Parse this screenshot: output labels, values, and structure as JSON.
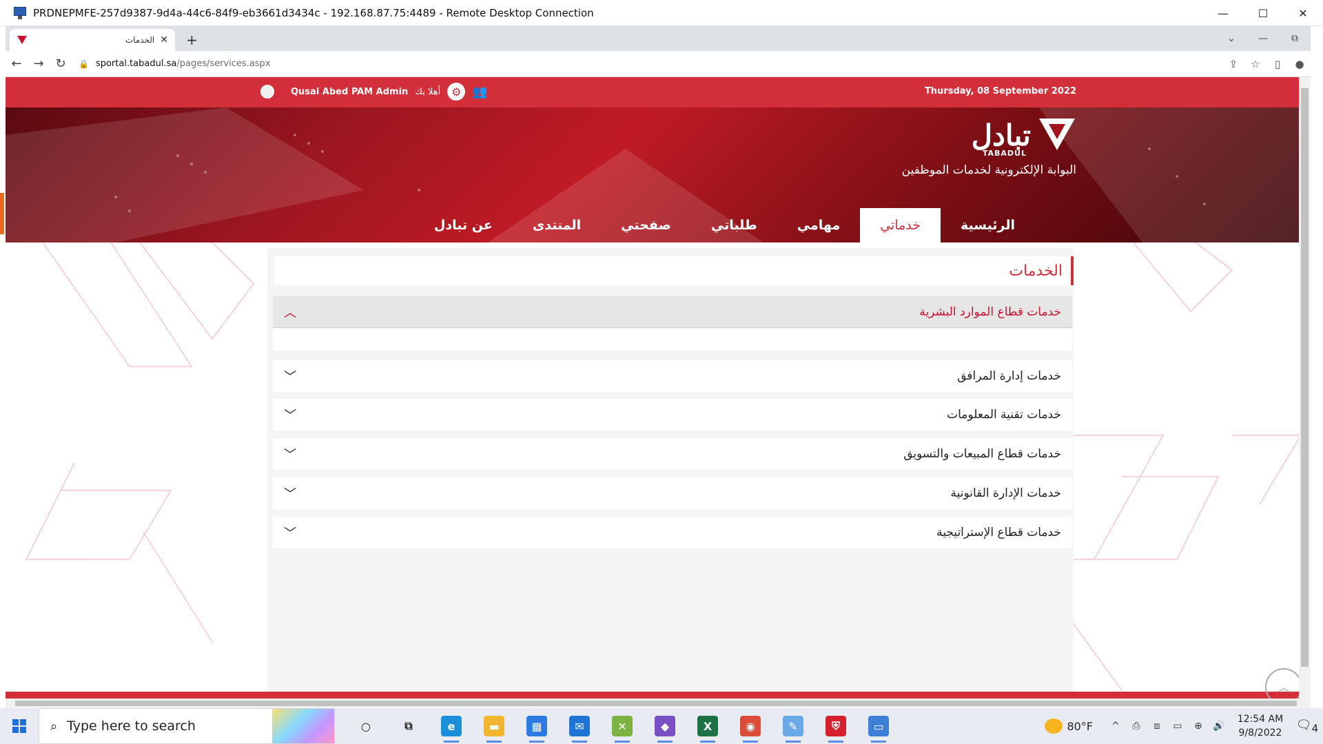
{
  "window": {
    "title": "PRDNEPMFE-257d9387-9d4a-44c6-84f9-eb3661d3434c - 192.168.87.75:4489 - Remote Desktop Connection",
    "controls": [
      "—",
      "☐",
      "✕"
    ]
  },
  "browser": {
    "tab_title": "الخدمات",
    "tab_close": "✕",
    "new_tab": "+",
    "tab_right": [
      "⌄",
      "—",
      "⧉"
    ],
    "url_host": "sportal.tabadul.sa",
    "url_path": "/pages/services.aspx",
    "nav": {
      "back": "←",
      "forward": "→",
      "reload": "↻"
    },
    "omni_right": [
      "⇪",
      "☆",
      "▯",
      "●"
    ]
  },
  "topbar": {
    "date": "Thursday, 08 September 2022",
    "user_name": "Qusai Abed PAM Admin",
    "welcome": "أهلا بك",
    "gear": "⚙",
    "group": "👥"
  },
  "brand": {
    "name_ar": "تبادل",
    "name_en": "TABADUL",
    "portal": "البوابة الإلكترونية لخدمات الموظفين"
  },
  "nav": [
    {
      "label": "الرئيسية",
      "active": false
    },
    {
      "label": "خدماتي",
      "active": true
    },
    {
      "label": "مهامي",
      "active": false
    },
    {
      "label": "طلباتي",
      "active": false
    },
    {
      "label": "صفحتي",
      "active": false
    },
    {
      "label": "المنتدى",
      "active": false
    },
    {
      "label": "عن تبادل",
      "active": false
    }
  ],
  "content": {
    "heading": "الخدمات",
    "sections": [
      {
        "label": "خدمات قطاع الموارد البشرية",
        "open": true,
        "chevron": "︿"
      },
      {
        "label": "خدمات إدارة المرافق",
        "open": false,
        "chevron": "﹀"
      },
      {
        "label": "خدمات تقنية المعلومات",
        "open": false,
        "chevron": "﹀"
      },
      {
        "label": "خدمات قطاع المبيعات والتسويق",
        "open": false,
        "chevron": "﹀"
      },
      {
        "label": "خدمات الإدارة القانونية",
        "open": false,
        "chevron": "﹀"
      },
      {
        "label": "خدمات قطاع الإستراتيجية",
        "open": false,
        "chevron": "﹀"
      }
    ]
  },
  "taskbar": {
    "search_placeholder": "Type here to search",
    "search_icon": "⌕",
    "apps": [
      {
        "name": "cortana-icon",
        "glyph": "○",
        "color": "transparent",
        "text_color": "#222"
      },
      {
        "name": "task-view-icon",
        "glyph": "⧉",
        "color": "transparent",
        "text_color": "#222"
      },
      {
        "name": "edge-icon",
        "glyph": "e",
        "color": "#1b8fd8",
        "text_color": "#fff"
      },
      {
        "name": "file-explorer-icon",
        "glyph": "▬",
        "color": "#f2b632",
        "text_color": "#fff"
      },
      {
        "name": "store-icon",
        "glyph": "▦",
        "color": "#2c7be5",
        "text_color": "#fff"
      },
      {
        "name": "mail-icon",
        "glyph": "✉",
        "color": "#1e74d4",
        "text_color": "#fff"
      },
      {
        "name": "tool-icon",
        "glyph": "✕",
        "color": "#7cb342",
        "text_color": "#fff"
      },
      {
        "name": "visual-studio-icon",
        "glyph": "◆",
        "color": "#7b4fc4",
        "text_color": "#fff"
      },
      {
        "name": "excel-icon",
        "glyph": "X",
        "color": "#1e7145",
        "text_color": "#fff"
      },
      {
        "name": "chrome-icon",
        "glyph": "◉",
        "color": "#dd4b39",
        "text_color": "#fff"
      },
      {
        "name": "paint-icon",
        "glyph": "✎",
        "color": "#6aa9e8",
        "text_color": "#fff"
      },
      {
        "name": "shield-app-icon",
        "glyph": "⛨",
        "color": "#d6202f",
        "text_color": "#fff"
      },
      {
        "name": "remote-desktop-icon",
        "glyph": "▭",
        "color": "#3d7fd6",
        "text_color": "#fff"
      }
    ],
    "weather_temp": "80°F",
    "tray": [
      "^",
      "⎙",
      "⧈",
      "▭",
      "⊕",
      "🔊"
    ],
    "time": "12:54 AM",
    "date": "9/8/2022",
    "notifications": "4"
  }
}
